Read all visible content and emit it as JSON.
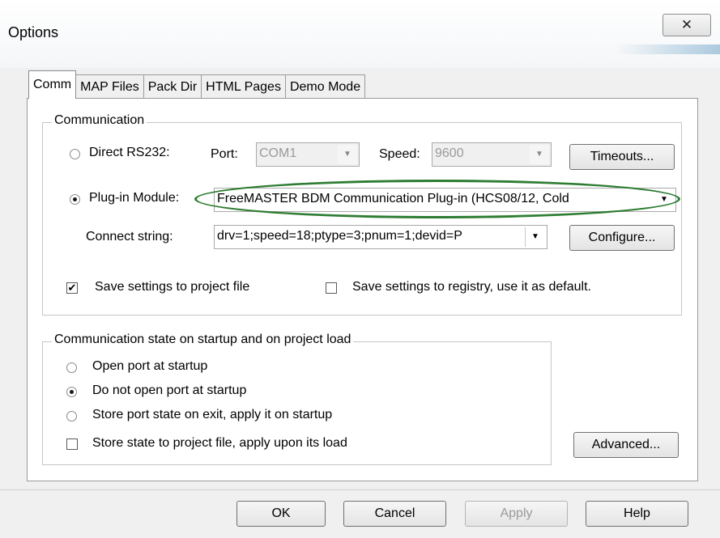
{
  "window": {
    "title": "Options",
    "close_glyph": "✕"
  },
  "tabs": [
    {
      "label": "Comm",
      "active": true
    },
    {
      "label": "MAP Files",
      "active": false
    },
    {
      "label": "Pack Dir",
      "active": false
    },
    {
      "label": "HTML Pages",
      "active": false
    },
    {
      "label": "Demo Mode",
      "active": false
    }
  ],
  "communication": {
    "legend": "Communication",
    "direct_rs232": {
      "label": "Direct RS232:",
      "selected": false
    },
    "port": {
      "label": "Port:",
      "value": "COM1"
    },
    "speed": {
      "label": "Speed:",
      "value": "9600"
    },
    "timeouts_button": "Timeouts...",
    "plugin_module": {
      "label": "Plug-in Module:",
      "selected": true,
      "value": "FreeMASTER BDM Communication Plug-in (HCS08/12, Cold"
    },
    "connect_string": {
      "label": "Connect string:",
      "value": "drv=1;speed=18;ptype=3;pnum=1;devid=P"
    },
    "configure_button": "Configure...",
    "save_project": {
      "label": "Save settings to project file",
      "checked": true
    },
    "save_registry": {
      "label": "Save settings to registry, use it as default.",
      "checked": false
    }
  },
  "startup": {
    "legend": "Communication state on startup and on project load",
    "open_port": {
      "label": "Open port at startup",
      "selected": false
    },
    "do_not_open": {
      "label": "Do not open port at startup",
      "selected": true
    },
    "store_port": {
      "label": "Store port state on exit, apply it on startup",
      "selected": false
    },
    "store_state": {
      "label": "Store state to project file, apply upon its load",
      "checked": false
    }
  },
  "advanced_button": "Advanced...",
  "footer": {
    "ok": "OK",
    "cancel": "Cancel",
    "apply": "Apply",
    "help": "Help"
  },
  "colors": {
    "highlight_oval": "#2e7d32"
  }
}
